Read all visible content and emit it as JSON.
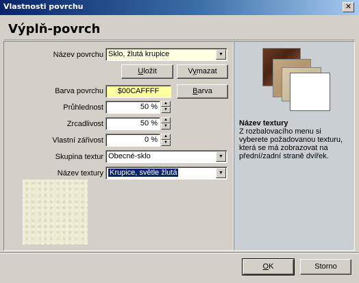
{
  "window": {
    "title": "Vlastnosti povrchu",
    "close_glyph": "✕"
  },
  "header": {
    "title": "Výplň-povrch"
  },
  "form": {
    "surface_name": {
      "label": "Název povrchu",
      "value": "Sklo, žlutá krupice"
    },
    "save_button": {
      "label_underlined": "U",
      "label_rest": "ložit"
    },
    "delete_button": {
      "label_pre": "V",
      "label_underlined": "y",
      "label_rest": "mazat"
    },
    "color": {
      "label": "Barva povrchu",
      "value": "$00CAFFFF",
      "button_underlined": "B",
      "button_rest": "arva"
    },
    "transparency": {
      "label": "Průhlednost",
      "value": "50 %"
    },
    "reflectivity": {
      "label": "Zrcadlivost",
      "value": "50 %"
    },
    "emission": {
      "label": "Vlastní zářivost",
      "value": "0 %"
    },
    "texture_group": {
      "label": "Skupina textur",
      "value": "Obecné-sklo"
    },
    "texture_name": {
      "label": "Název textury",
      "value": "Krupice, světle žlutá"
    }
  },
  "help": {
    "title": "Název textury",
    "text": "Z rozbalovacího menu si vyberete požadovanou texturu, která se má zobrazovat na přední/zadní straně dvířek."
  },
  "footer": {
    "ok_underlined": "O",
    "ok_rest": "K",
    "cancel": "Storno"
  },
  "colors": {
    "titlebar_start": "#0a246a",
    "titlebar_end": "#a6caf0",
    "face": "#d4d0c8",
    "help_panel": "#c9cfd3",
    "combo_bg": "#ffffe1",
    "color_field_bg": "#ffffa0",
    "selection": "#0a246a"
  },
  "icons": {
    "combo_arrow": "down-arrow-icon",
    "spin_up": "up-arrow-icon",
    "spin_down": "down-arrow-icon"
  }
}
